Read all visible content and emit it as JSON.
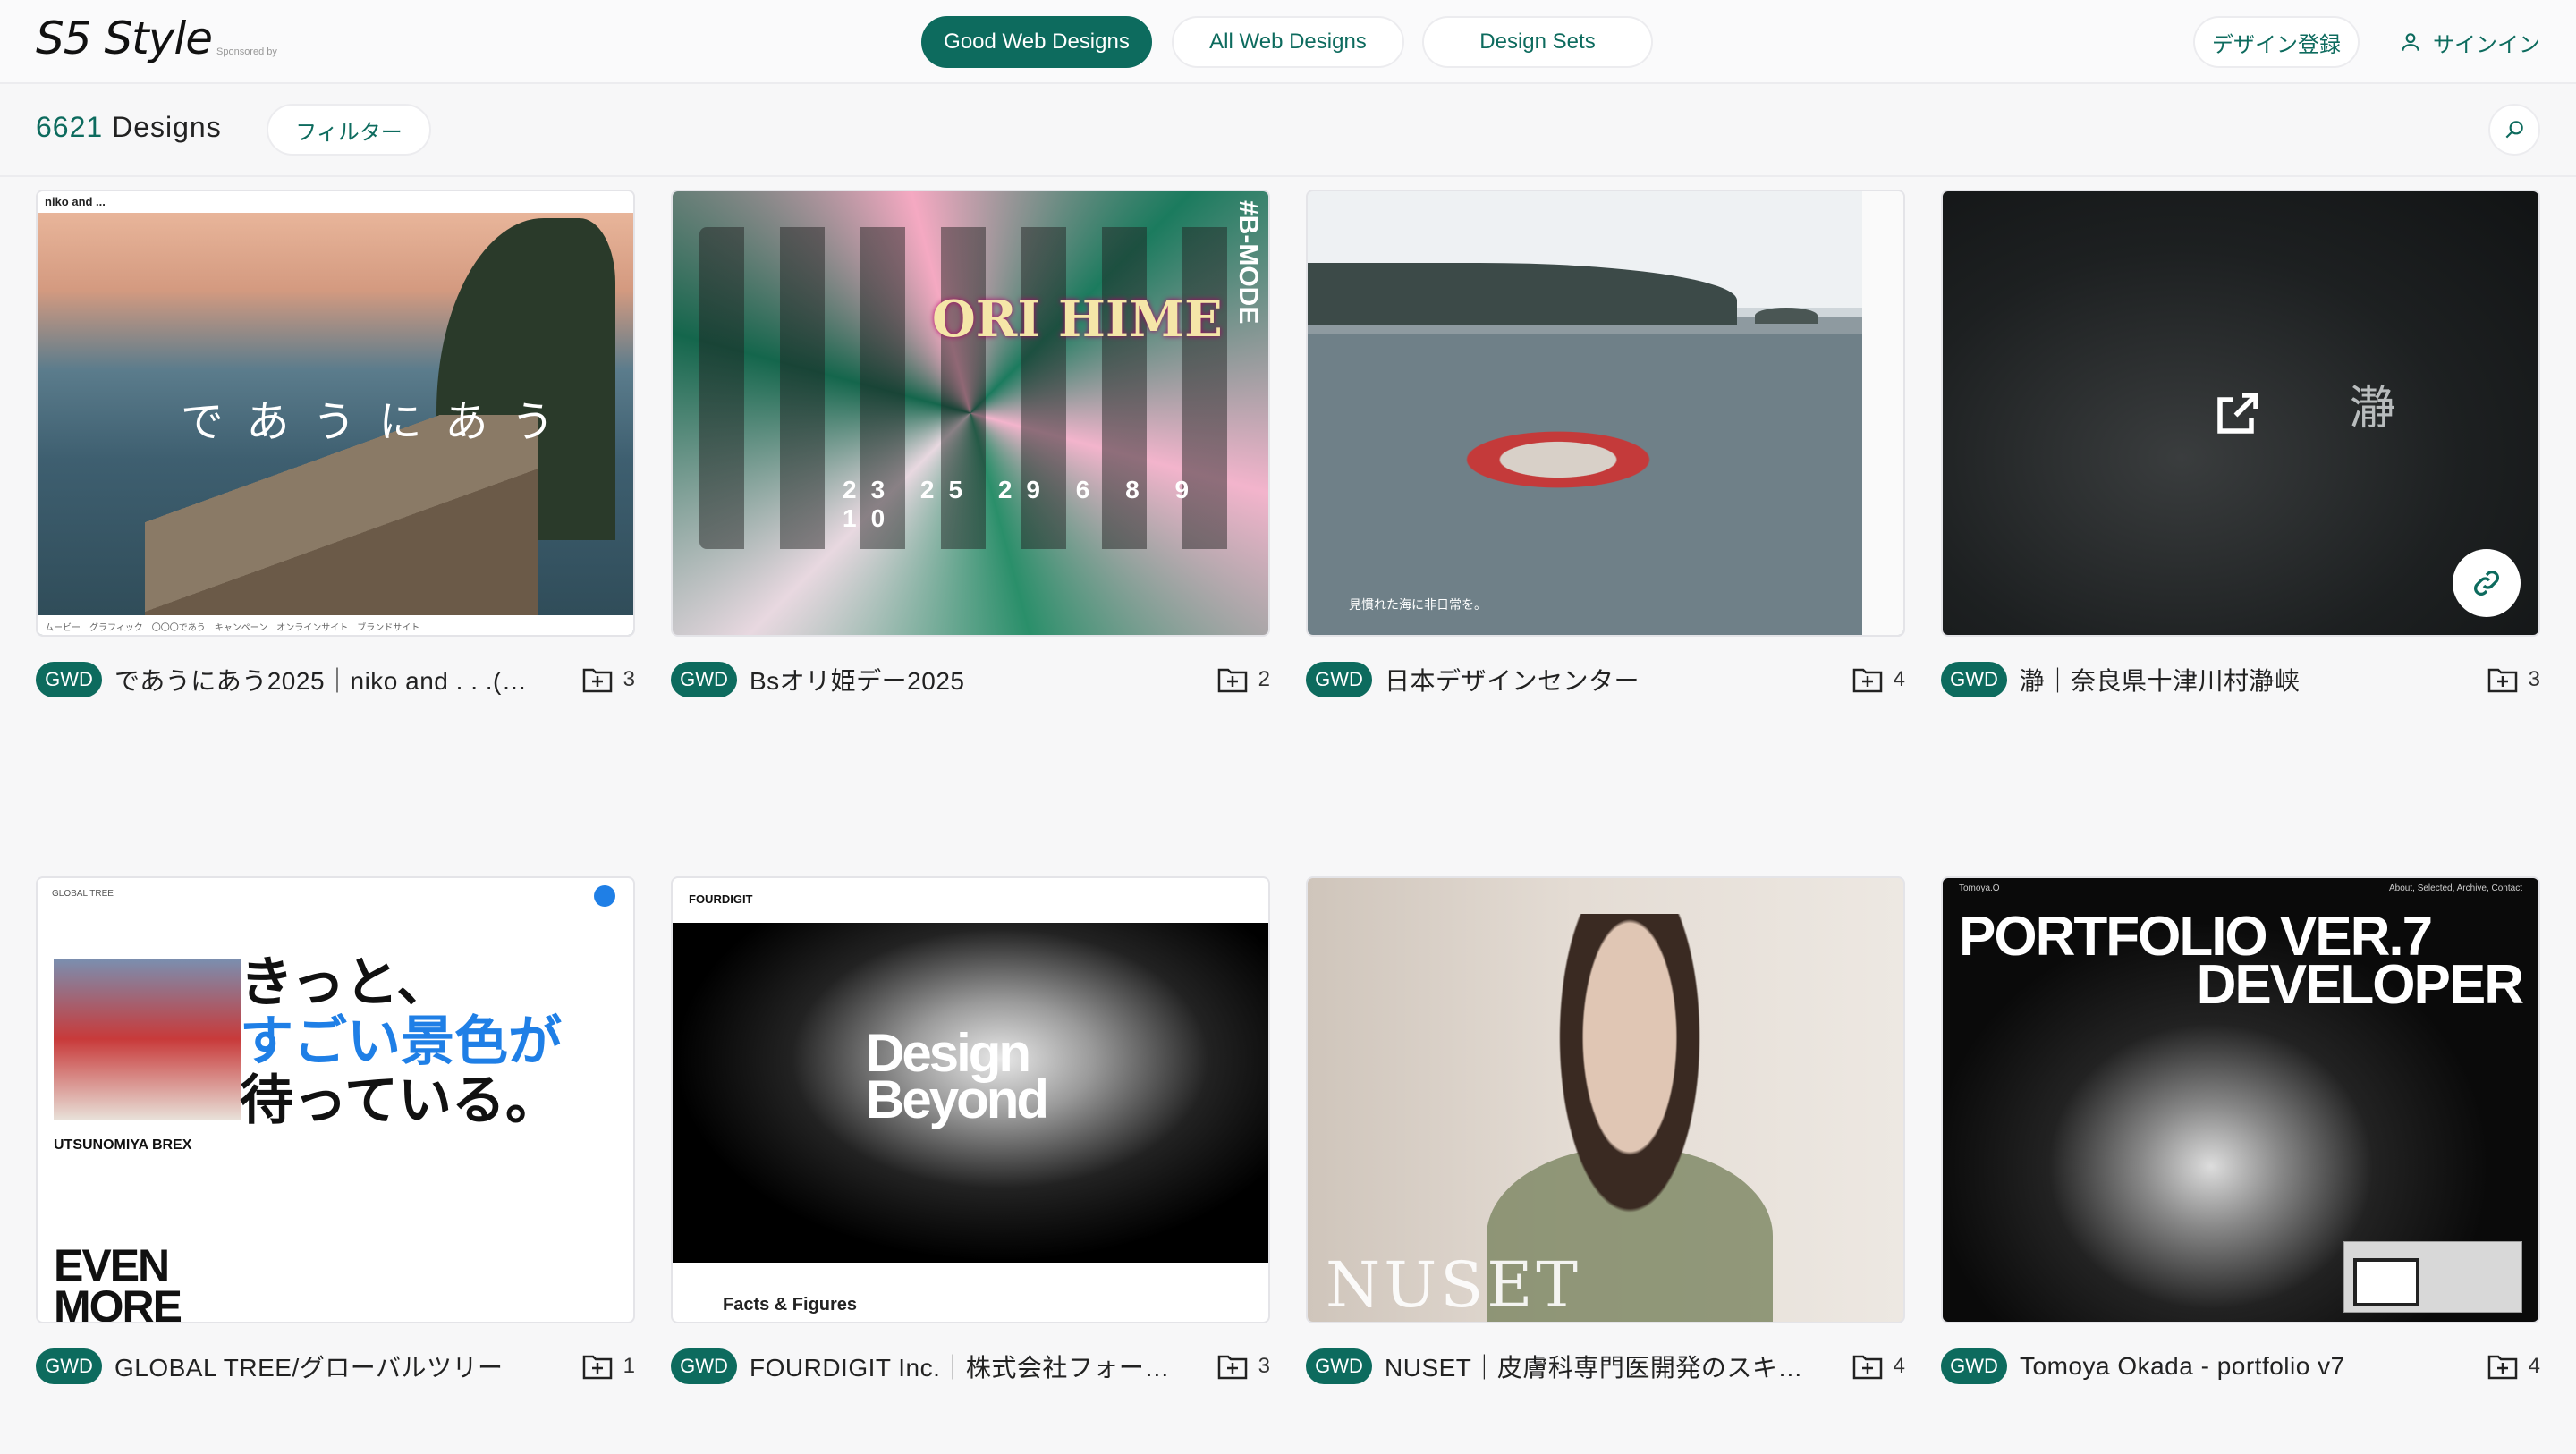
{
  "header": {
    "logo": "S5 Style",
    "sponsored": "Sponsored by",
    "tabs": [
      "Good Web Designs",
      "All Web Designs",
      "Design Sets"
    ],
    "register": "デザイン登録",
    "signin": "サインイン"
  },
  "subheader": {
    "count": "6621",
    "count_label": "Designs",
    "filter": "フィルター"
  },
  "cards": [
    {
      "badge": "GWD",
      "title": "であうにあう2025｜niko and . . .(…",
      "sets": "3",
      "topbar": "niko and ...",
      "headline": "であうにあう",
      "footer": "ムービー　グラフィック　〇〇〇であう　キャンペーン　オンラインサイト　ブランドサイト"
    },
    {
      "badge": "GWD",
      "title": "Bsオリ姫デー2025",
      "sets": "2",
      "headline": "ORI HIME",
      "vertical": "#B-MODE",
      "dates": "23 25 29 6 8 9 10"
    },
    {
      "badge": "GWD",
      "title": "日本デザインセンター",
      "sets": "4",
      "caption": "見慣れた海に非日常を。"
    },
    {
      "badge": "GWD",
      "title": "瀞｜奈良県十津川村瀞峡",
      "sets": "3",
      "kanji": "瀞"
    },
    {
      "badge": "GWD",
      "title": "GLOBAL TREE/グローバルツリー",
      "sets": "1",
      "brand": "GLOBAL TREE",
      "line1": "きっと、",
      "line2": "すごい景色が",
      "line3": "待っている。",
      "team": "UTSUNOMIYA BREX",
      "slogan1": "EVEN",
      "slogan2": "MORE"
    },
    {
      "badge": "GWD",
      "title": "FOURDIGIT Inc.｜株式会社フォー…",
      "sets": "3",
      "brand": "FOURDIGIT",
      "headline1": "Design",
      "headline2": "Beyond",
      "section": "Facts & Figures"
    },
    {
      "badge": "GWD",
      "title": "NUSET｜皮膚科専門医開発のスキ…",
      "sets": "4",
      "brand": "NUSET"
    },
    {
      "badge": "GWD",
      "title": "Tomoya Okada - portfolio v7",
      "sets": "4",
      "headline1": "PORTFOLIO VER.7",
      "headline2": "DEVELOPER",
      "tag": "Tomoya.O",
      "menu": "About, Selected, Archive, Contact"
    }
  ],
  "colors": {
    "accent": "#0d6b5e",
    "background": "#f7f7f8"
  }
}
